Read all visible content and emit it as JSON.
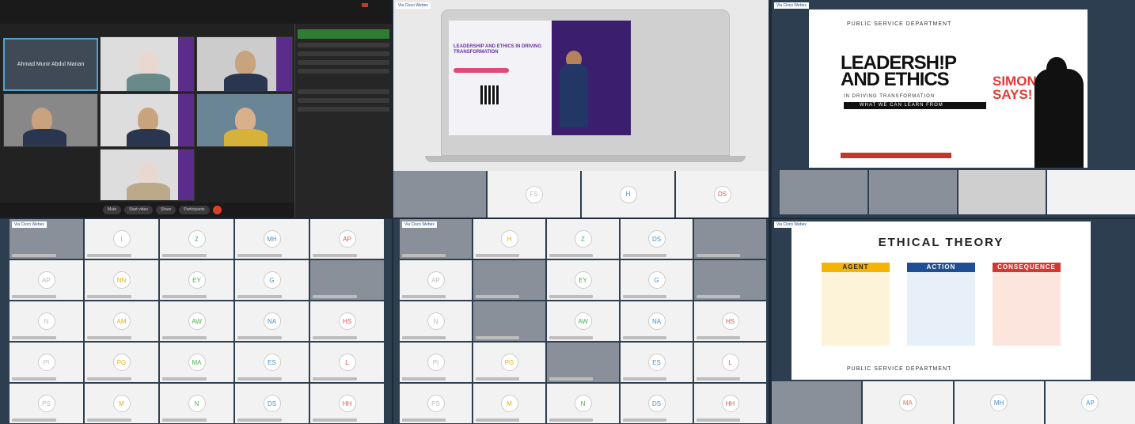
{
  "panel1": {
    "presenter_name": "Ahmad Munir Abdul Manan",
    "controls": [
      "Mute",
      "Start video",
      "Share",
      "Participants"
    ]
  },
  "panel2": {
    "brand": "Via Cisco Webex",
    "poster_title": "LEADERSHIP AND ETHICS IN DRIVING TRANSFORMATION",
    "strip": [
      "FS",
      "H",
      "DS"
    ]
  },
  "panel3": {
    "brand": "Via Cisco Webex",
    "department": "PUBLIC SERVICE DEPARTMENT",
    "title_line1": "LEADERSH!P",
    "title_line2": "AND ETHICS",
    "subtitle": "IN DRIVING TRANSFORMATION",
    "banner": "WHAT WE CAN LEARN FROM",
    "simon": "SIMON",
    "says": "SAYS!"
  },
  "panel4": {
    "brand": "Via Cisco Webex",
    "tiles": [
      "",
      "I",
      "Z",
      "MH",
      "AP",
      "AP",
      "NN",
      "EY",
      "G",
      "",
      "N",
      "AM",
      "AW",
      "NA",
      "HS",
      "PI",
      "PG",
      "MA",
      "ES",
      "L",
      "PS",
      "M",
      "N",
      "DS",
      "HH"
    ]
  },
  "panel5": {
    "brand": "Via Cisco Webex",
    "tiles": [
      "",
      "H",
      "Z",
      "DS",
      "",
      "AP",
      "",
      "EY",
      "G",
      "",
      "N",
      "",
      "AW",
      "NA",
      "HS",
      "PI",
      "PG",
      "",
      "ES",
      "L",
      "PS",
      "M",
      "N",
      "DS",
      "HH"
    ]
  },
  "panel6": {
    "brand": "Via Cisco Webex",
    "title": "ETHICAL THEORY",
    "agent": "AGENT",
    "action": "ACTION",
    "consequence": "CONSEQUENCE",
    "department": "PUBLIC SERVICE DEPARTMENT",
    "strip": [
      "MA",
      "MH",
      "AP"
    ]
  }
}
